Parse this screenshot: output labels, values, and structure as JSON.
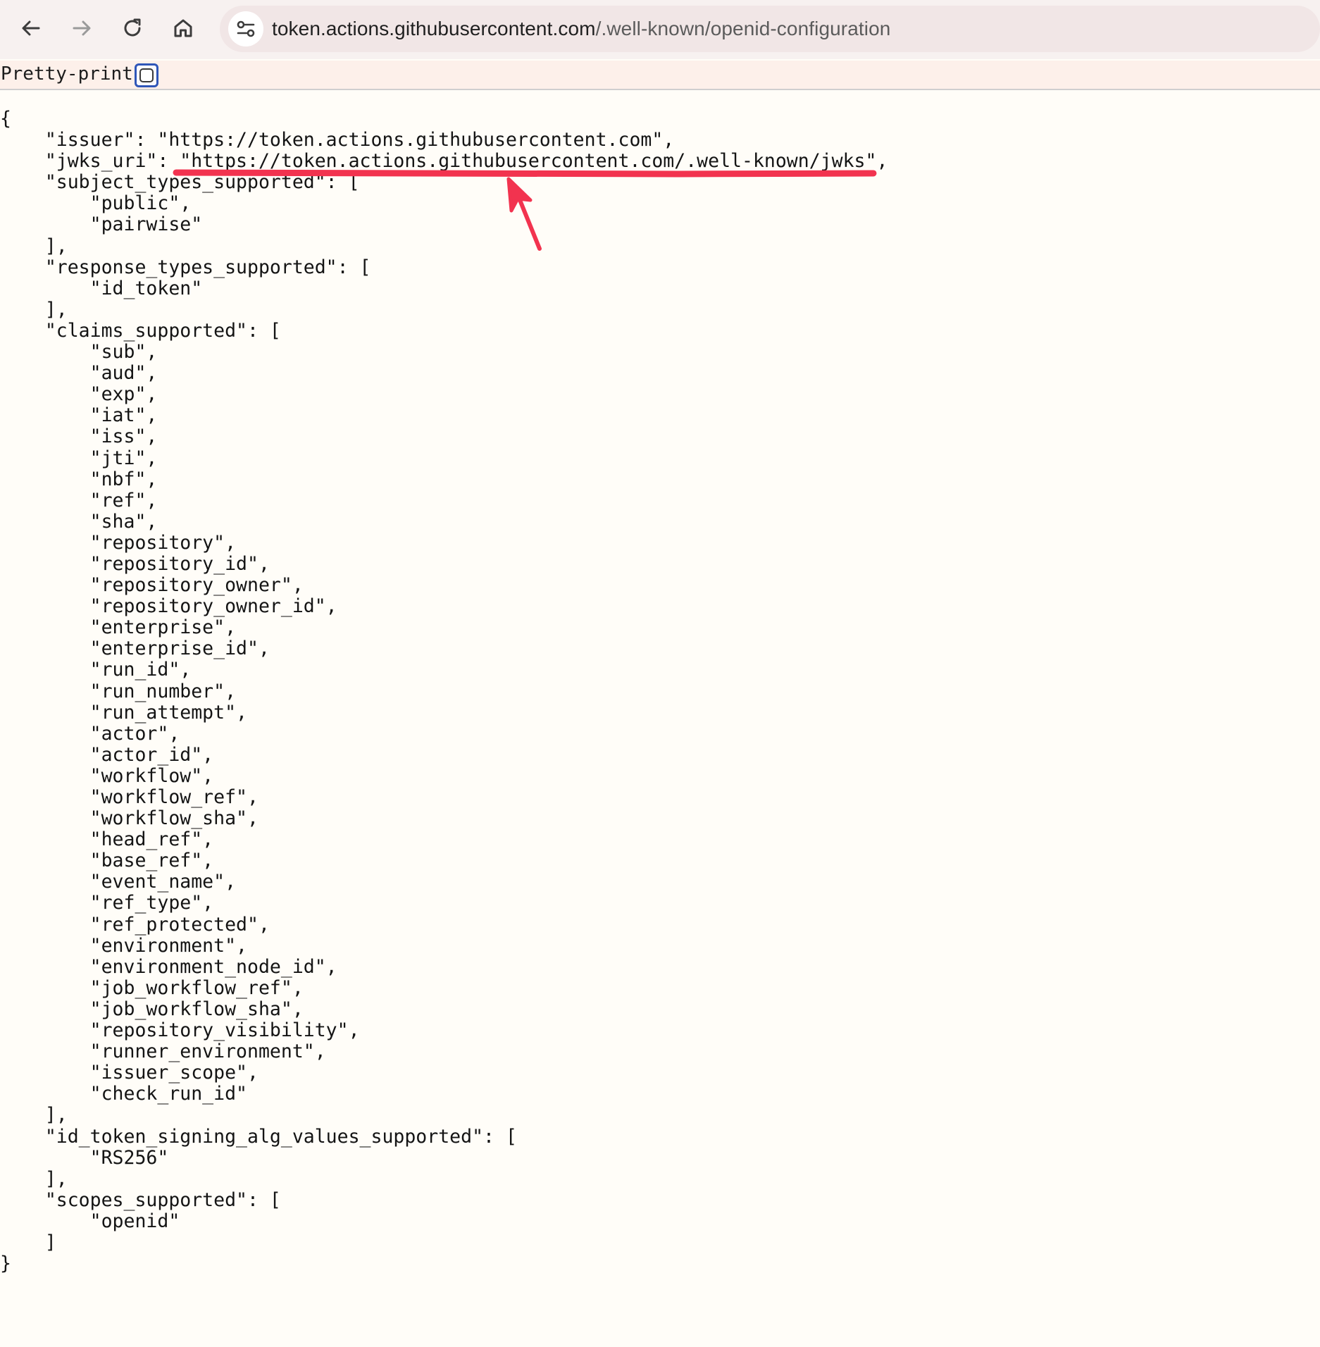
{
  "browser": {
    "url_host": "token.actions.githubusercontent.com",
    "url_path": "/.well-known/openid-configuration"
  },
  "viewer": {
    "pretty_print_label": "Pretty-print",
    "pretty_print_checked": false
  },
  "json_lines": [
    "{",
    "    \"issuer\": \"https://token.actions.githubusercontent.com\",",
    "    \"jwks_uri\": \"https://token.actions.githubusercontent.com/.well-known/jwks\",",
    "    \"subject_types_supported\": [",
    "        \"public\",",
    "        \"pairwise\"",
    "    ],",
    "    \"response_types_supported\": [",
    "        \"id_token\"",
    "    ],",
    "    \"claims_supported\": [",
    "        \"sub\",",
    "        \"aud\",",
    "        \"exp\",",
    "        \"iat\",",
    "        \"iss\",",
    "        \"jti\",",
    "        \"nbf\",",
    "        \"ref\",",
    "        \"sha\",",
    "        \"repository\",",
    "        \"repository_id\",",
    "        \"repository_owner\",",
    "        \"repository_owner_id\",",
    "        \"enterprise\",",
    "        \"enterprise_id\",",
    "        \"run_id\",",
    "        \"run_number\",",
    "        \"run_attempt\",",
    "        \"actor\",",
    "        \"actor_id\",",
    "        \"workflow\",",
    "        \"workflow_ref\",",
    "        \"workflow_sha\",",
    "        \"head_ref\",",
    "        \"base_ref\",",
    "        \"event_name\",",
    "        \"ref_type\",",
    "        \"ref_protected\",",
    "        \"environment\",",
    "        \"environment_node_id\",",
    "        \"job_workflow_ref\",",
    "        \"job_workflow_sha\",",
    "        \"repository_visibility\",",
    "        \"runner_environment\",",
    "        \"issuer_scope\",",
    "        \"check_run_id\"",
    "    ],",
    "    \"id_token_signing_alg_values_supported\": [",
    "        \"RS256\"",
    "    ],",
    "    \"scopes_supported\": [",
    "        \"openid\"",
    "    ]",
    "}"
  ],
  "icons": {
    "back": "arrow-left-icon",
    "forward": "arrow-right-icon",
    "reload": "reload-icon",
    "home": "home-icon",
    "site_info": "tune-icon"
  },
  "colors": {
    "annotation": "#f2334f",
    "checkbox_focus": "#2f56b8",
    "page_background": "#fffdf8"
  }
}
